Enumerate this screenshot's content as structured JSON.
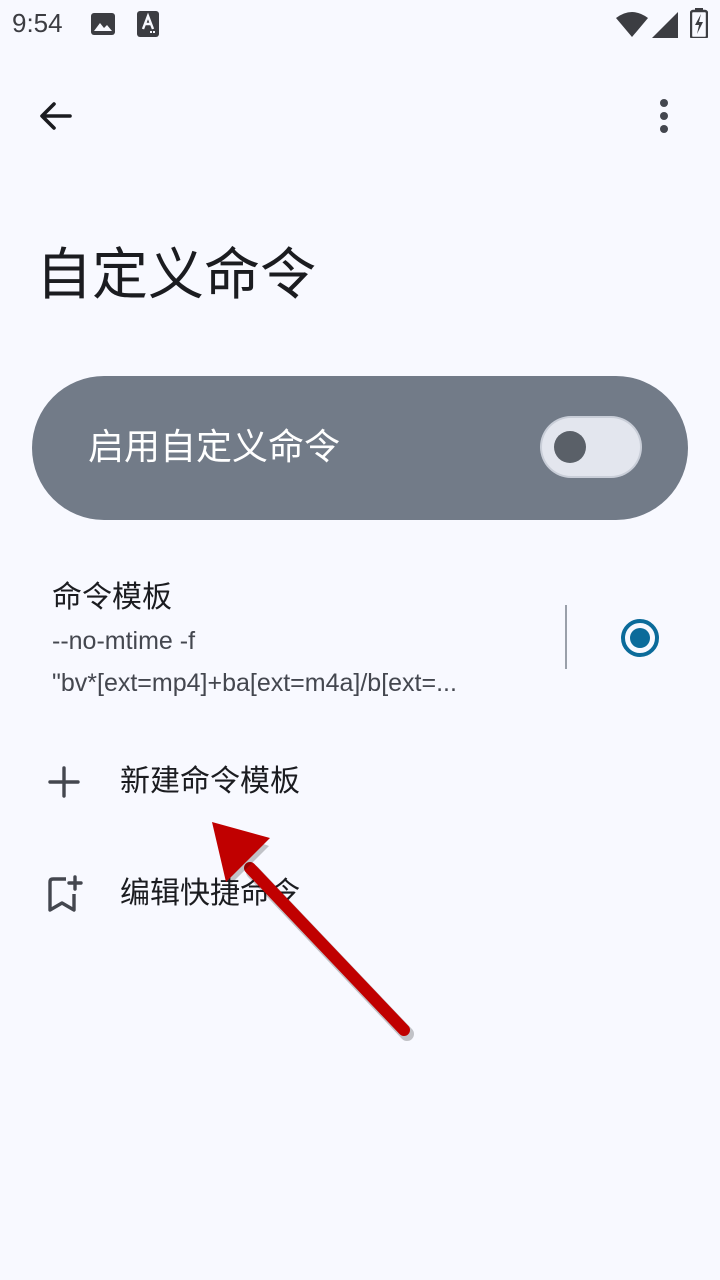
{
  "status_bar": {
    "time": "9:54",
    "icons": [
      "image-icon",
      "text-a-icon",
      "wifi-icon",
      "signal-icon",
      "battery-charging-icon"
    ]
  },
  "top_bar": {
    "back_icon": "arrow-back-icon",
    "more_icon": "more-vert-icon"
  },
  "page": {
    "title": "自定义命令"
  },
  "enable_card": {
    "label": "启用自定义命令",
    "switch_on": false,
    "card_color": "#727b88"
  },
  "template": {
    "title": "命令模板",
    "command_line_1": "--no-mtime -f",
    "command_line_2": "\"bv*[ext=mp4]+ba[ext=m4a]/b[ext=...",
    "selected": true,
    "radio_color": "#0b6b9a"
  },
  "actions": [
    {
      "label": "新建命令模板",
      "icon": "add-icon"
    },
    {
      "label": "编辑快捷命令",
      "icon": "bookmark-add-icon"
    }
  ],
  "annotation": {
    "arrow_color": "#c00000"
  }
}
